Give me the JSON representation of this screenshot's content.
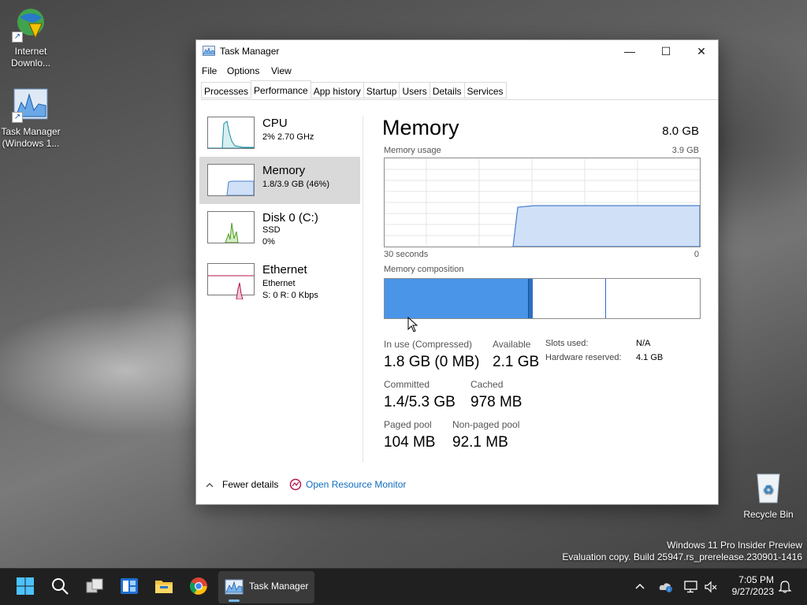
{
  "desktop": {
    "icons": [
      {
        "label": "Internet Downlo...",
        "icon": "internet-download-manager-icon"
      },
      {
        "label": "Task Manager (Windows 1...",
        "icon": "task-manager-icon"
      },
      {
        "label": "Recycle Bin",
        "icon": "recycle-bin-icon"
      }
    ],
    "watermark_line1": "Windows 11 Pro Insider Preview",
    "watermark_line2": "Evaluation copy. Build 25947.rs_prerelease.230901-1416"
  },
  "window": {
    "title": "Task Manager",
    "controls": {
      "minimize": "—",
      "maximize": "☐",
      "close": "✕"
    },
    "menu": [
      "File",
      "Options",
      "View"
    ],
    "tabs": [
      "Processes",
      "Performance",
      "App history",
      "Startup",
      "Users",
      "Details",
      "Services"
    ],
    "active_tab": "Performance"
  },
  "sidebar": {
    "items": [
      {
        "title": "CPU",
        "sub1": "2% 2.70 GHz",
        "sub2": "",
        "color": "#1a8fa0"
      },
      {
        "title": "Memory",
        "sub1": "1.8/3.9 GB (46%)",
        "sub2": "",
        "color": "#4a7fcf",
        "selected": true
      },
      {
        "title": "Disk 0 (C:)",
        "sub1": "SSD",
        "sub2": "0%",
        "color": "#4d9a1f"
      },
      {
        "title": "Ethernet",
        "sub1": "Ethernet",
        "sub2": "S: 0 R: 0 Kbps",
        "color": "#b5164a"
      }
    ]
  },
  "memory": {
    "title": "Memory",
    "total": "8.0 GB",
    "usage_label": "Memory usage",
    "usage_max": "3.9 GB",
    "time_label": "30 seconds",
    "time_end": "0",
    "composition_label": "Memory composition",
    "in_use_label": "In use (Compressed)",
    "in_use_value": "1.8 GB (0 MB)",
    "available_label": "Available",
    "available_value": "2.1 GB",
    "committed_label": "Committed",
    "committed_value": "1.4/5.3 GB",
    "cached_label": "Cached",
    "cached_value": "978 MB",
    "paged_label": "Paged pool",
    "paged_value": "104 MB",
    "nonpaged_label": "Non-paged pool",
    "nonpaged_value": "92.1 MB",
    "slots_label": "Slots used:",
    "slots_value": "N/A",
    "hw_reserved_label": "Hardware reserved:",
    "hw_reserved_value": "4.1 GB"
  },
  "footer": {
    "fewer_details": "Fewer details",
    "resource_monitor": "Open Resource Monitor"
  },
  "taskbar": {
    "active_app": "Task Manager",
    "time": "7:05 PM",
    "date": "9/27/2023"
  },
  "colors": {
    "accent": "#0f6cbd",
    "memory_fill": "#4a95e8"
  }
}
